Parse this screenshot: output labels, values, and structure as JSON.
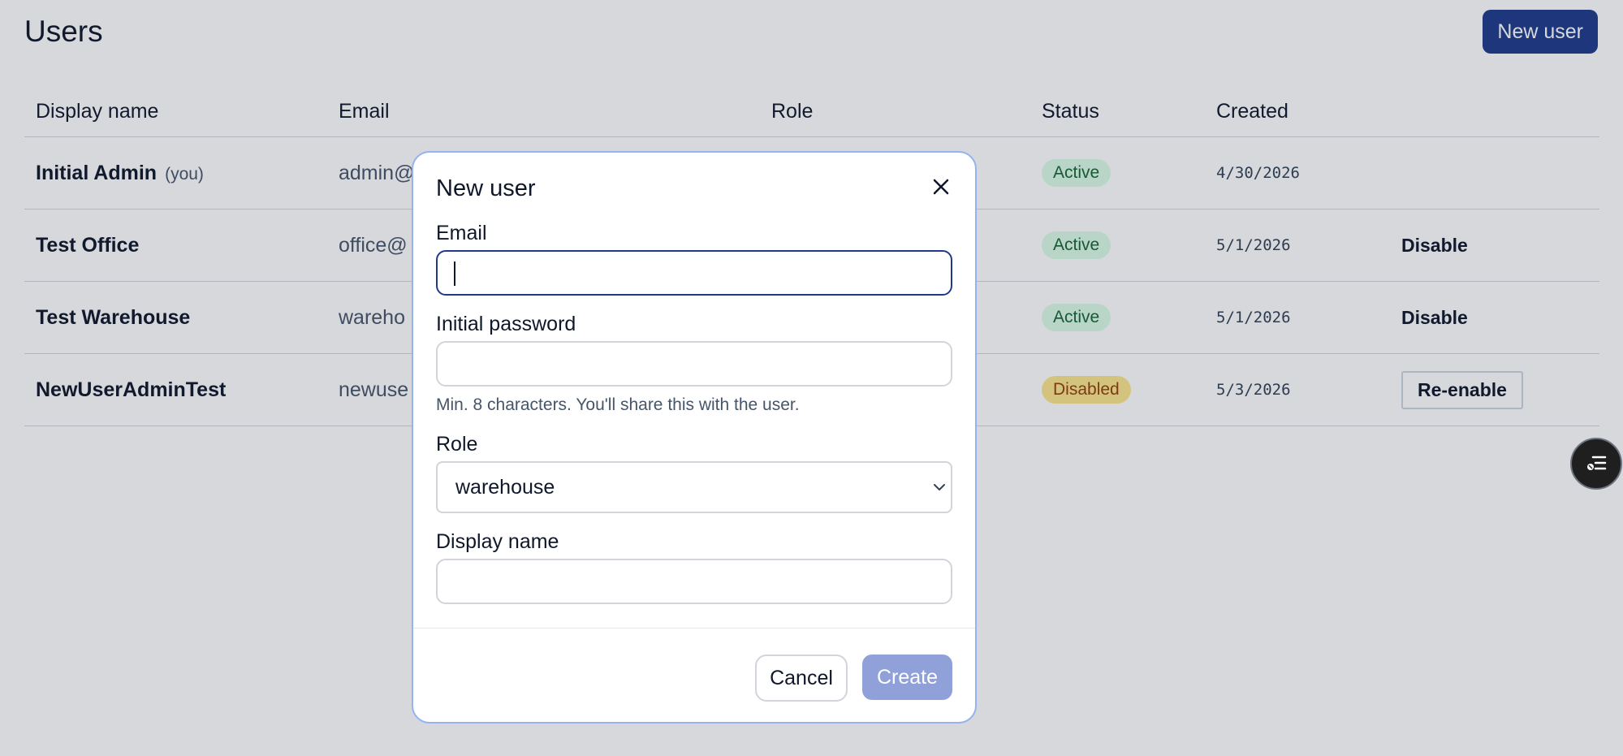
{
  "page": {
    "title": "Users",
    "new_user_label": "New user"
  },
  "table": {
    "headers": [
      "Display name",
      "Email",
      "Role",
      "Status",
      "Created"
    ],
    "rows": [
      {
        "name": "Initial Admin",
        "you": "(you)",
        "email": "admin@",
        "status": "Active",
        "created": "4/30/2026",
        "action": ""
      },
      {
        "name": "Test Office",
        "email": "office@",
        "status": "Active",
        "created": "5/1/2026",
        "action": "Disable"
      },
      {
        "name": "Test Warehouse",
        "email": "wareho",
        "status": "Active",
        "created": "5/1/2026",
        "action": "Disable"
      },
      {
        "name": "NewUserAdminTest",
        "email": "newuse",
        "status": "Disabled",
        "created": "5/3/2026",
        "action": "Re-enable"
      }
    ]
  },
  "modal": {
    "title": "New user",
    "email_label": "Email",
    "email_value": "",
    "password_label": "Initial password",
    "password_value": "",
    "password_hint": "Min. 8 characters. You'll share this with the user.",
    "role_label": "Role",
    "role_value": "warehouse",
    "display_name_label": "Display name",
    "display_name_value": "",
    "cancel_label": "Cancel",
    "create_label": "Create"
  },
  "icons": {
    "close": "close-icon",
    "chevron": "chevron-down-icon",
    "fab": "list-menu-icon"
  },
  "colors": {
    "primary": "#1e3a8a",
    "primary_disabled": "#8fa1d8",
    "active_bg": "#dcfce7",
    "active_text": "#166534",
    "disabled_bg": "#fde68a",
    "disabled_text": "#92400e",
    "modal_border": "#93b4f0"
  }
}
